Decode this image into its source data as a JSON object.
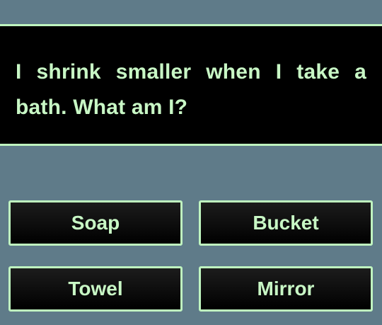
{
  "question": {
    "text": "I shrink smaller when I take a bath. What am I?"
  },
  "answers": [
    {
      "label": "Soap"
    },
    {
      "label": "Bucket"
    },
    {
      "label": "Towel"
    },
    {
      "label": "Mirror"
    }
  ],
  "colors": {
    "background": "#5f7b89",
    "panel": "#000000",
    "accent": "#bff5bf",
    "text": "#c8f7c5"
  }
}
